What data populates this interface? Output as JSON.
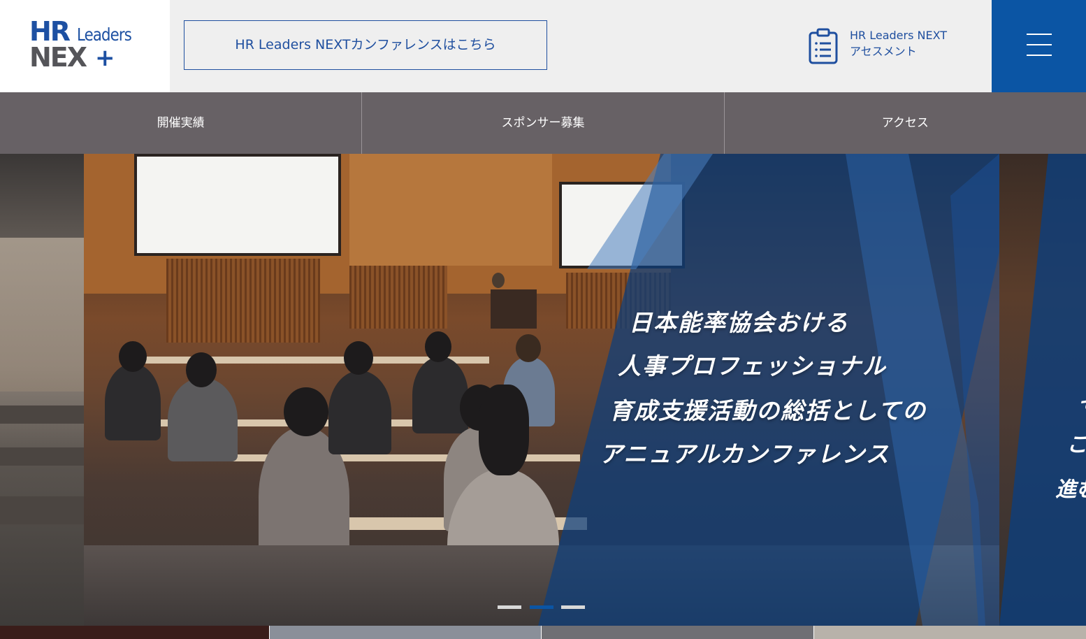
{
  "header": {
    "logo": {
      "word_hr": "HR",
      "word_leaders": "Leaders",
      "word_next": "NEX",
      "word_plus": "+"
    },
    "conference_link_label": "HR Leaders NEXTカンファレンスはこちら",
    "assessment": {
      "icon": "clipboard-list-icon",
      "line1": "HR Leaders NEXT",
      "line2": "アセスメント"
    },
    "menu_icon": "hamburger-menu-icon"
  },
  "nav": {
    "items": [
      {
        "label": "開催実績"
      },
      {
        "label": "スポンサー募集"
      },
      {
        "label": "アクセス"
      }
    ]
  },
  "hero": {
    "lines": [
      "日本能率協会おける",
      "人事プロフェッショナル",
      "育成支援活動の総括としての",
      "アニュアルカンファレンス"
    ],
    "next_slide_peek": [
      "そ",
      "こ",
      "進む"
    ],
    "dots": {
      "count": 3,
      "active_index": 1
    }
  },
  "colors": {
    "brand_blue": "#0b55a4",
    "text_blue": "#1f4f9f",
    "nav_gray": "#676165",
    "header_bg": "#efefef",
    "overlay_blue": "#0d3f7d"
  }
}
